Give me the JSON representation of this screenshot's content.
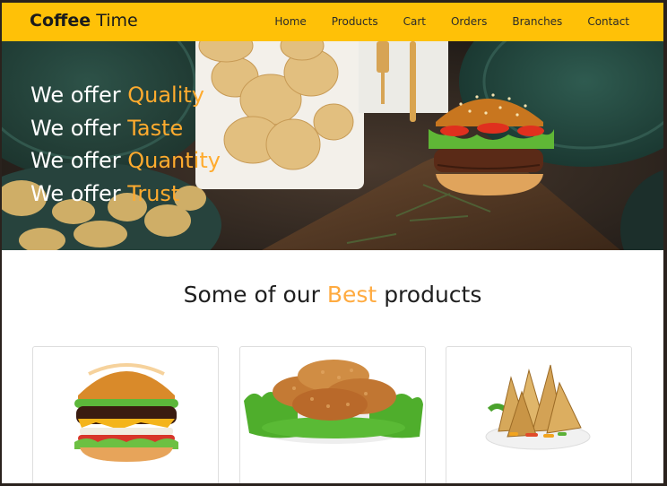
{
  "navbar": {
    "brand_bold": "Coffee",
    "brand_light": "Time",
    "links": [
      "Home",
      "Products",
      "Cart",
      "Orders",
      "Branches",
      "Contact"
    ]
  },
  "hero": {
    "lines": [
      {
        "prefix": "We offer",
        "accent": "Quality"
      },
      {
        "prefix": "We offer",
        "accent": "Taste"
      },
      {
        "prefix": "We offer",
        "accent": "Quantity"
      },
      {
        "prefix": "We offer",
        "accent": "Trust"
      }
    ]
  },
  "products_section": {
    "title_before": "Some of our",
    "title_accent": "Best",
    "title_after": "products",
    "cards": [
      {
        "image": "burger-image"
      },
      {
        "image": "fried-cutlets-image"
      },
      {
        "image": "samosa-image"
      }
    ]
  },
  "colors": {
    "navbar": "#ffc107",
    "accent": "#ffab2e",
    "hero_bg": "#2e2823"
  }
}
